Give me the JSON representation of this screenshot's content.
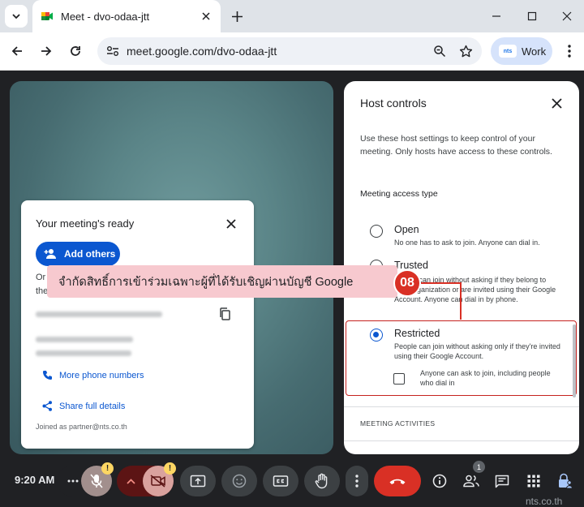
{
  "browser": {
    "tab_title": "Meet - dvo-odaa-jtt",
    "url": "meet.google.com/dvo-odaa-jtt",
    "profile_badge": "nts",
    "profile_label": "Work"
  },
  "ready_card": {
    "title": "Your meeting's ready",
    "add_others_label": "Add others",
    "partial_line_1": "Or",
    "partial_line_2": "the",
    "more_phone_numbers": "More phone numbers",
    "share_full_details": "Share full details",
    "joined_as": "Joined as partner@nts.co.th"
  },
  "host_controls": {
    "title": "Host controls",
    "description": "Use these host settings to keep control of your meeting. Only hosts have access to these controls.",
    "access_heading": "Meeting access type",
    "options": [
      {
        "label": "Open",
        "description": "No one has to ask to join. Anyone can dial in.",
        "checked": false
      },
      {
        "label": "Trusted",
        "description": "People can join without asking if they belong to your organization or are invited using their Google Account. Anyone can dial in by phone.",
        "checked": false
      },
      {
        "label": "Restricted",
        "description": "People can join without asking only if they're invited using their Google Account.",
        "checked": true
      }
    ],
    "checkbox_label": "Anyone can ask to join, including people who dial in",
    "section_heading": "MEETING ACTIVITIES"
  },
  "annotation": {
    "text": "จำกัดสิทธิ์การเข้าร่วมเฉพาะผู้ที่ได้รับเชิญผ่านบัญชี Google",
    "step": "08"
  },
  "bottom_bar": {
    "time": "9:20 AM",
    "warning_mark": "!",
    "people_count": "1"
  },
  "watermark": "nts.co.th",
  "colors": {
    "accent": "#0b57d0",
    "annotation_red": "#d93025",
    "callout_pink": "#f7c9cf"
  }
}
